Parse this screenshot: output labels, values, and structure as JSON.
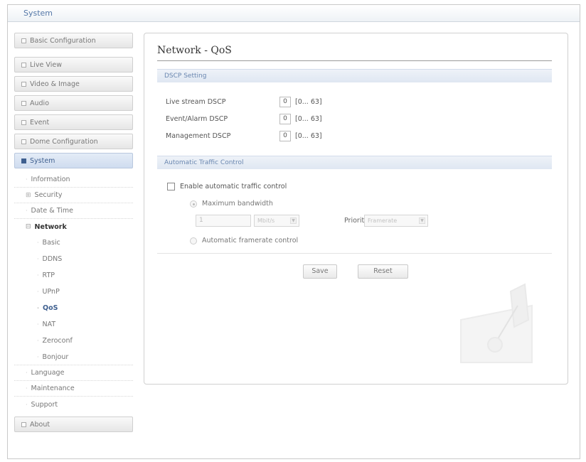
{
  "window": {
    "title": "System"
  },
  "sidebar": {
    "top_items": [
      {
        "label": "Basic Configuration"
      },
      {
        "label": "Live View"
      },
      {
        "label": "Video & Image"
      },
      {
        "label": "Audio"
      },
      {
        "label": "Event"
      },
      {
        "label": "Dome Configuration"
      },
      {
        "label": "System"
      }
    ],
    "system_items": [
      {
        "label": "Information"
      },
      {
        "label": "Security"
      },
      {
        "label": "Date & Time"
      },
      {
        "label": "Network"
      }
    ],
    "network_items": [
      {
        "label": "Basic"
      },
      {
        "label": "DDNS"
      },
      {
        "label": "RTP"
      },
      {
        "label": "UPnP"
      },
      {
        "label": "QoS"
      },
      {
        "label": "NAT"
      },
      {
        "label": "Zeroconf"
      },
      {
        "label": "Bonjour"
      }
    ],
    "system_items_after": [
      {
        "label": "Language"
      },
      {
        "label": "Maintenance"
      },
      {
        "label": "Support"
      }
    ],
    "about": {
      "label": "About"
    }
  },
  "main": {
    "title": "Network - QoS",
    "dscp": {
      "heading": "DSCP Setting",
      "rows": [
        {
          "label": "Live stream DSCP",
          "value": "0",
          "range": "[0... 63]"
        },
        {
          "label": "Event/Alarm DSCP",
          "value": "0",
          "range": "[0... 63]"
        },
        {
          "label": "Management DSCP",
          "value": "0",
          "range": "[0... 63]"
        }
      ]
    },
    "atc": {
      "heading": "Automatic Traffic Control",
      "enable_label": "Enable automatic traffic control",
      "max_bw_label": "Maximum bandwidth",
      "bw_value": "1",
      "bw_unit": "Mbit/s",
      "priority_label": "Priority",
      "priority_value": "Framerate",
      "auto_fr_label": "Automatic framerate control"
    },
    "buttons": {
      "save": "Save",
      "reset": "Reset"
    }
  },
  "colors": {
    "accent": "#3e5f8f",
    "section_header": "#dfe7f2"
  }
}
